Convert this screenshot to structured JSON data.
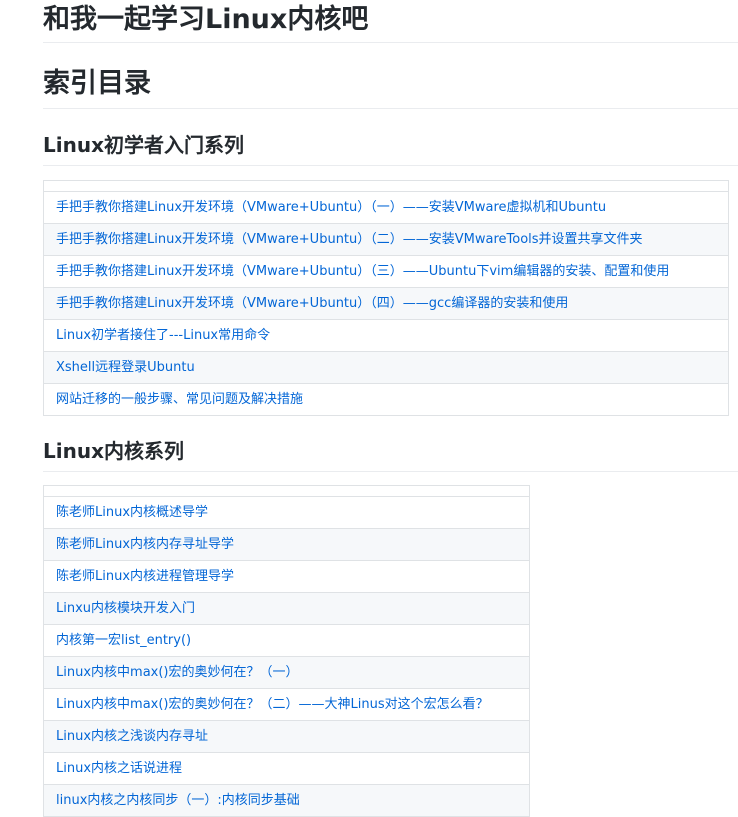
{
  "page": {
    "title": "和我一起学习Linux内核吧",
    "index_heading": "索引目录"
  },
  "beginner": {
    "heading": "Linux初学者入门系列",
    "links": [
      "手把手教你搭建Linux开发环境（VMware+Ubuntu）（一）——安装VMware虚拟机和Ubuntu",
      "手把手教你搭建Linux开发环境（VMware+Ubuntu）（二）——安装VMwareTools并设置共享文件夹",
      "手把手教你搭建Linux开发环境（VMware+Ubuntu）（三）——Ubuntu下vim编辑器的安装、配置和使用",
      "手把手教你搭建Linux开发环境（VMware+Ubuntu）（四）——gcc编译器的安装和使用",
      "Linux初学者接住了---Linux常用命令",
      "Xshell远程登录Ubuntu",
      "网站迁移的一般步骤、常见问题及解决措施"
    ]
  },
  "kernel": {
    "heading": "Linux内核系列",
    "links": [
      "陈老师Linux内核概述导学",
      "陈老师Linux内核内存寻址导学",
      "陈老师Linux内核进程管理导学",
      "Linxu内核模块开发入门",
      "内核第一宏list_entry()",
      "Linux内核中max()宏的奥妙何在？（一）",
      "Linux内核中max()宏的奥妙何在？（二）——大神Linus对这个宏怎么看？",
      "Linux内核之浅谈内存寻址",
      "Linux内核之话说进程",
      "linux内核之内核同步（一）:内核同步基础"
    ]
  },
  "colors": {
    "link": "#0366d6",
    "heading": "#24292e",
    "border": "#dfe2e5",
    "stripe": "#f6f8fa"
  }
}
